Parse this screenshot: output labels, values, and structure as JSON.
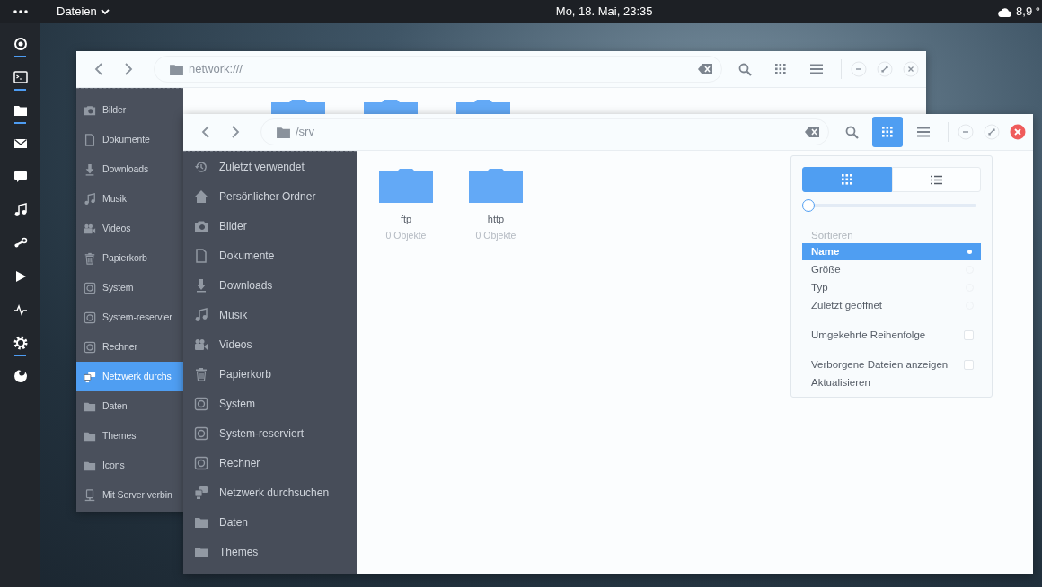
{
  "top_bar": {
    "app_menu": "Dateien",
    "clock": "Mo, 18. Mai, 23:35",
    "weather": "8,9 °"
  },
  "dock": [
    {
      "kind": "ring",
      "running": true
    },
    {
      "kind": "terminal",
      "running": true
    },
    {
      "kind": "folder",
      "running": true
    },
    {
      "kind": "envelope",
      "running": false
    },
    {
      "kind": "speech",
      "running": false
    },
    {
      "kind": "music",
      "running": false
    },
    {
      "kind": "lever",
      "running": false
    },
    {
      "kind": "play",
      "running": false
    },
    {
      "kind": "pulse",
      "running": false
    },
    {
      "kind": "gear",
      "running": true
    },
    {
      "kind": "swirl",
      "running": false
    }
  ],
  "back_window": {
    "path": "network:///",
    "sidebar": [
      {
        "kind": "camera",
        "label": "Bilder",
        "selected": false
      },
      {
        "kind": "document",
        "label": "Dokumente",
        "selected": false
      },
      {
        "kind": "download",
        "label": "Downloads",
        "selected": false
      },
      {
        "kind": "music",
        "label": "Musik",
        "selected": false
      },
      {
        "kind": "video",
        "label": "Videos",
        "selected": false
      },
      {
        "kind": "trash",
        "label": "Papierkorb",
        "selected": false
      },
      {
        "kind": "disk",
        "label": "System",
        "selected": false
      },
      {
        "kind": "disk",
        "label": "System-reservier",
        "selected": false
      },
      {
        "kind": "disk",
        "label": "Rechner",
        "selected": false
      },
      {
        "kind": "network",
        "label": "Netzwerk durchs",
        "selected": true
      },
      {
        "kind": "folder",
        "label": "Daten",
        "selected": false
      },
      {
        "kind": "folder",
        "label": "Themes",
        "selected": false
      },
      {
        "kind": "folder",
        "label": "Icons",
        "selected": false
      },
      {
        "kind": "server",
        "label": "Mit Server verbin",
        "selected": false
      }
    ],
    "files": [
      {
        "kind": "folder"
      },
      {
        "kind": "folder"
      },
      {
        "kind": "folder"
      }
    ]
  },
  "front_window": {
    "path": "/srv",
    "view_menu_open": true,
    "sidebar": [
      {
        "kind": "history",
        "label": "Zuletzt verwendet",
        "selected": false
      },
      {
        "kind": "home",
        "label": "Persönlicher Ordner",
        "selected": false
      },
      {
        "kind": "camera",
        "label": "Bilder",
        "selected": false
      },
      {
        "kind": "document",
        "label": "Dokumente",
        "selected": false
      },
      {
        "kind": "download",
        "label": "Downloads",
        "selected": false
      },
      {
        "kind": "music",
        "label": "Musik",
        "selected": false
      },
      {
        "kind": "video",
        "label": "Videos",
        "selected": false
      },
      {
        "kind": "trash",
        "label": "Papierkorb",
        "selected": false
      },
      {
        "kind": "disk",
        "label": "System",
        "selected": false
      },
      {
        "kind": "disk",
        "label": "System-reserviert",
        "selected": false
      },
      {
        "kind": "disk",
        "label": "Rechner",
        "selected": false
      },
      {
        "kind": "network",
        "label": "Netzwerk durchsuchen",
        "selected": false
      },
      {
        "kind": "folder",
        "label": "Daten",
        "selected": false
      },
      {
        "kind": "folder",
        "label": "Themes",
        "selected": false
      }
    ],
    "files": [
      {
        "name": "ftp",
        "info": "0 Objekte"
      },
      {
        "name": "http",
        "info": "0 Objekte"
      }
    ]
  },
  "view_menu": {
    "views": [
      {
        "kind": "grid",
        "selected": true
      },
      {
        "kind": "list",
        "selected": false
      }
    ],
    "zoom": {
      "level": 0.0
    },
    "sort_heading": "Sortieren",
    "sort_options": [
      {
        "label": "Name",
        "selected": true
      },
      {
        "label": "Größe",
        "selected": false
      },
      {
        "label": "Typ",
        "selected": false
      },
      {
        "label": "Zuletzt geöffnet",
        "selected": false
      }
    ],
    "toggles": [
      {
        "label": "Umgekehrte Reihenfolge",
        "checked": false
      },
      {
        "label": "Verborgene Dateien anzeigen",
        "checked": false
      }
    ],
    "actions": [
      "Aktualisieren"
    ]
  }
}
